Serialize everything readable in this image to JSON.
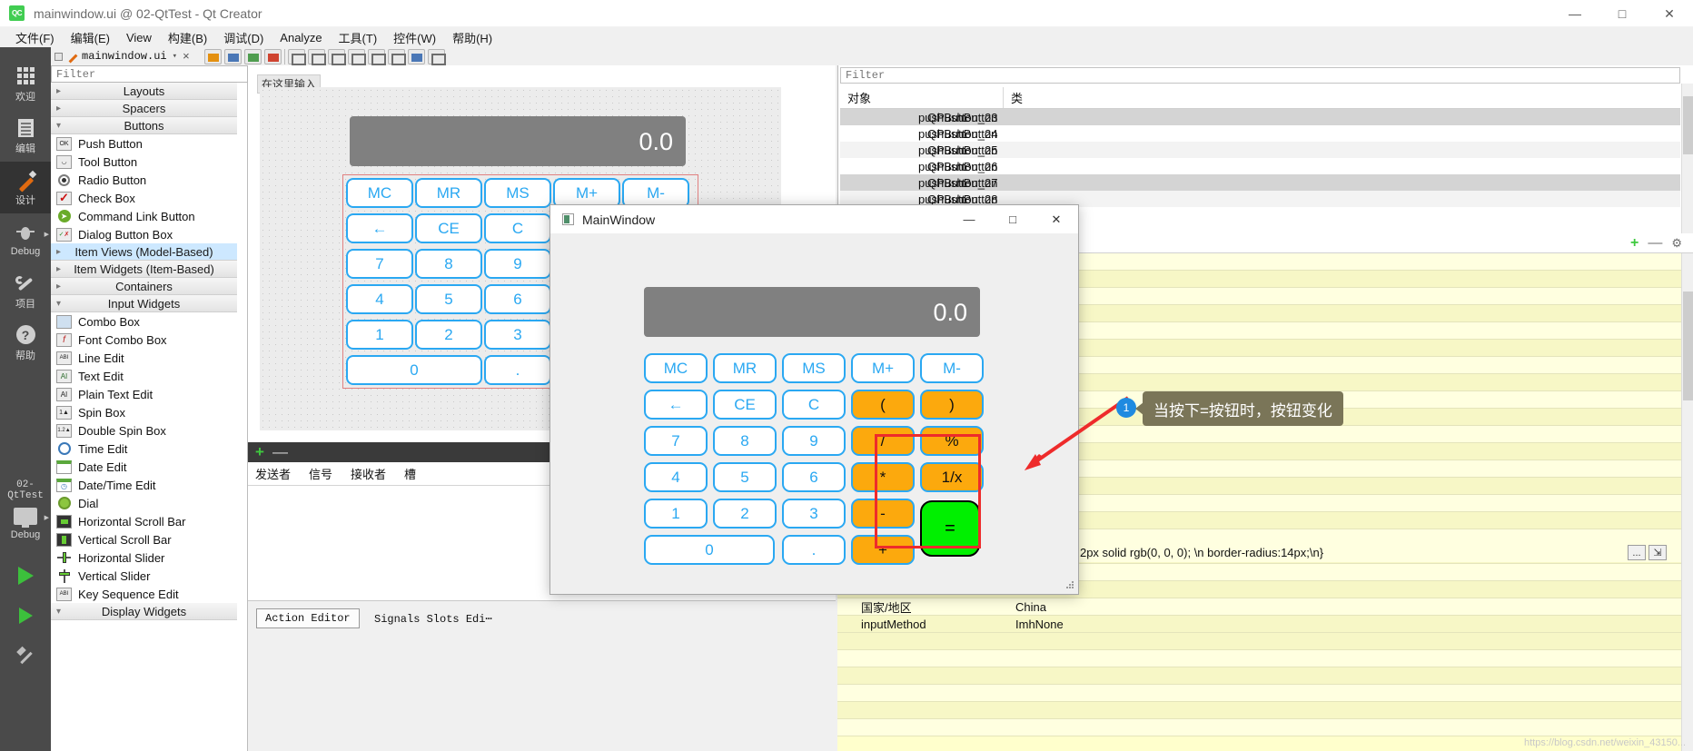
{
  "window": {
    "title": "mainwindow.ui @ 02-QtTest - Qt Creator",
    "logo": "qt-creator-logo",
    "minimize": "—",
    "maximize": "□",
    "close": "✕"
  },
  "menubar": {
    "items": [
      "文件(F)",
      "编辑(E)",
      "View",
      "构建(B)",
      "调试(D)",
      "Analyze",
      "工具(T)",
      "控件(W)",
      "帮助(H)"
    ]
  },
  "modebar": {
    "items": [
      {
        "label": "欢迎",
        "icon": "grid-icon",
        "active": false
      },
      {
        "label": "编辑",
        "icon": "document-icon",
        "active": false
      },
      {
        "label": "设计",
        "icon": "pencil-icon",
        "active": true
      },
      {
        "label": "Debug",
        "icon": "bug-icon",
        "active": false
      },
      {
        "label": "项目",
        "icon": "wrench-icon",
        "active": false
      },
      {
        "label": "帮助",
        "icon": "question-icon",
        "active": false
      }
    ],
    "kit_name": "02-QtTest",
    "kit_mode": "Debug"
  },
  "editor_tab": {
    "filename": "mainwindow.ui",
    "close": "×",
    "chevron": "▾"
  },
  "widgetbox": {
    "filter_placeholder": "Filter",
    "groups": [
      {
        "label": "Layouts",
        "expanded": false,
        "items": []
      },
      {
        "label": "Spacers",
        "expanded": false,
        "items": []
      },
      {
        "label": "Buttons",
        "expanded": true,
        "items": [
          {
            "label": "Push Button",
            "icon": "push-button-icon"
          },
          {
            "label": "Tool Button",
            "icon": "tool-button-icon"
          },
          {
            "label": "Radio Button",
            "icon": "radio-button-icon"
          },
          {
            "label": "Check Box",
            "icon": "check-box-icon"
          },
          {
            "label": "Command Link Button",
            "icon": "command-link-icon"
          },
          {
            "label": "Dialog Button Box",
            "icon": "dialog-button-box-icon"
          }
        ]
      },
      {
        "label": "Item Views (Model-Based)",
        "expanded": false,
        "selected": true,
        "items": []
      },
      {
        "label": "Item Widgets (Item-Based)",
        "expanded": false,
        "items": []
      },
      {
        "label": "Containers",
        "expanded": false,
        "items": []
      },
      {
        "label": "Input Widgets",
        "expanded": true,
        "items": [
          {
            "label": "Combo Box",
            "icon": "combo-box-icon"
          },
          {
            "label": "Font Combo Box",
            "icon": "font-combo-box-icon"
          },
          {
            "label": "Line Edit",
            "icon": "line-edit-icon"
          },
          {
            "label": "Text Edit",
            "icon": "text-edit-icon"
          },
          {
            "label": "Plain Text Edit",
            "icon": "plain-text-edit-icon"
          },
          {
            "label": "Spin Box",
            "icon": "spin-box-icon"
          },
          {
            "label": "Double Spin Box",
            "icon": "double-spin-box-icon"
          },
          {
            "label": "Time Edit",
            "icon": "time-edit-icon"
          },
          {
            "label": "Date Edit",
            "icon": "date-edit-icon"
          },
          {
            "label": "Date/Time Edit",
            "icon": "date-time-edit-icon"
          },
          {
            "label": "Dial",
            "icon": "dial-icon"
          },
          {
            "label": "Horizontal Scroll Bar",
            "icon": "h-scrollbar-icon"
          },
          {
            "label": "Vertical Scroll Bar",
            "icon": "v-scrollbar-icon"
          },
          {
            "label": "Horizontal Slider",
            "icon": "h-slider-icon"
          },
          {
            "label": "Vertical Slider",
            "icon": "v-slider-icon"
          },
          {
            "label": "Key Sequence Edit",
            "icon": "key-sequence-edit-icon"
          }
        ]
      },
      {
        "label": "Display Widgets",
        "expanded": true,
        "items": []
      }
    ]
  },
  "form_editor": {
    "hint": "在这里输入",
    "display_value": "0.0",
    "keys": [
      [
        "MC",
        "MR",
        "MS",
        "M+",
        "M-"
      ],
      [
        "←",
        "CE",
        "C"
      ],
      [
        "7",
        "8",
        "9"
      ],
      [
        "4",
        "5",
        "6"
      ],
      [
        "1",
        "2",
        "3"
      ],
      [
        "0",
        "."
      ]
    ]
  },
  "signal_editor": {
    "columns": [
      "发送者",
      "信号",
      "接收者",
      "槽"
    ],
    "add": "+",
    "remove": "—",
    "tabs": [
      "Action Editor",
      "Signals  Slots Edi⋯"
    ]
  },
  "object_inspector": {
    "filter_placeholder": "Filter",
    "columns": [
      "对象",
      "类"
    ],
    "rows": [
      {
        "name": "pushButton_23",
        "class": "QPushButton"
      },
      {
        "name": "pushButton_24",
        "class": "QPushButton"
      },
      {
        "name": "pushButton_25",
        "class": "QPushButton"
      },
      {
        "name": "pushButton_26",
        "class": "QPushButton"
      },
      {
        "name": "pushButton_27",
        "class": "QPushButton"
      },
      {
        "name": "pushButton_28",
        "class": "QPushButton"
      }
    ]
  },
  "property_editor": {
    "toolbar": {
      "add": "+",
      "remove": "—",
      "config": "⚙"
    },
    "stylesheet_value": "order:2px solid rgb(0, 0, 0); \\n   border-radius:14px;\\n}",
    "stylesheet_ellipsis": "...",
    "stylesheet_button": "⇲",
    "rows": [
      {
        "key": "国家/地区",
        "value": "China"
      },
      {
        "key": "inputMethod",
        "value": "ImhNone"
      }
    ]
  },
  "mainwindow_dialog": {
    "title": "MainWindow",
    "icon": "app-icon",
    "minimize": "—",
    "maximize": "□",
    "close": "✕",
    "display_value": "0.0",
    "rows": [
      [
        "MC",
        "MR",
        "MS",
        "M+",
        "M-"
      ],
      [
        "←",
        "CE",
        "C",
        "(",
        ")"
      ],
      [
        "7",
        "8",
        "9",
        "/",
        "%"
      ],
      [
        "4",
        "5",
        "6",
        "*",
        "1/x"
      ],
      [
        "1",
        "2",
        "3",
        "-",
        "="
      ],
      [
        "0",
        ".",
        "+"
      ]
    ],
    "operator_keys": [
      "(",
      ")",
      "/",
      "%",
      "*",
      "1/x",
      "-",
      "+"
    ],
    "equals_key": "=",
    "colors": {
      "operator_bg": "#fca90d",
      "equals_bg": "#00f000",
      "key_border": "#2aa8f2",
      "display_bg": "#808080"
    }
  },
  "annotation": {
    "badge": "1",
    "text": "当按下=按钮时，按钮变化",
    "selection_color": "#ee2b2b",
    "arrow_color": "#ee2b2b"
  },
  "watermark": "https://blog.csdn.net/weixin_43150..."
}
